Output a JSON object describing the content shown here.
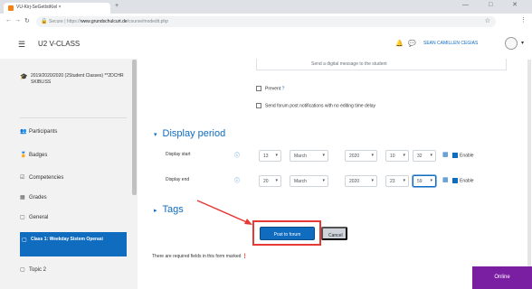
{
  "browser": {
    "tab_title": "VU-Kirj-SeGetIstKiel ×",
    "url_prefix": "Secure | https://",
    "url_main": "www.grundschulcurt.de",
    "url_rest": "/course/modedit.php",
    "newtab": "+",
    "win_controls": "— □ ✕",
    "back": "←",
    "forward": "→",
    "reload": "↻",
    "star": "☆",
    "menu": "⋮"
  },
  "header": {
    "site_name": "U2 V-CLASS",
    "user_name": "SEAN CAMILLEN CEGIAS",
    "bell": "🔔",
    "chat": "💬",
    "user_menu": "▾"
  },
  "drawer": {
    "course_text": "2019/2020/2020 (2Student Classes) **2DCHR SKIBLISS",
    "items": [
      {
        "icon": "👥",
        "label": "Participants"
      },
      {
        "icon": "🏅",
        "label": "Badges"
      },
      {
        "icon": "☑",
        "label": "Competencies"
      },
      {
        "icon": "▦",
        "label": "Grades"
      },
      {
        "icon": "▢",
        "label": "General"
      }
    ],
    "active_item": "Class 1: Weekday Sistem Operasi",
    "last_item": "Topic 2"
  },
  "form": {
    "infobox_text": "Send a digital message to the student",
    "check1": "Prevent",
    "check2": "Send forum post notifications with no editing time delay",
    "display_period_title": "Display period",
    "display_start_label": "Display start",
    "display_end_label": "Display end",
    "start": {
      "day": "13",
      "month": "March",
      "year": "2020",
      "hour": "10",
      "minute": "32"
    },
    "end": {
      "day": "20",
      "month": "March",
      "year": "2020",
      "hour": "23",
      "minute": "59"
    },
    "enable_label": "Enable",
    "tags_title": "Tags",
    "save_label": "Post to forum",
    "cancel_label": "Cancel",
    "required_note": "There are required fields in this form marked",
    "required_mark": "❗"
  },
  "online_badge": "Online",
  "colors": {
    "primary": "#0f6cbf",
    "annotation_red": "#e53935",
    "online_purple": "#7b1fa2"
  }
}
